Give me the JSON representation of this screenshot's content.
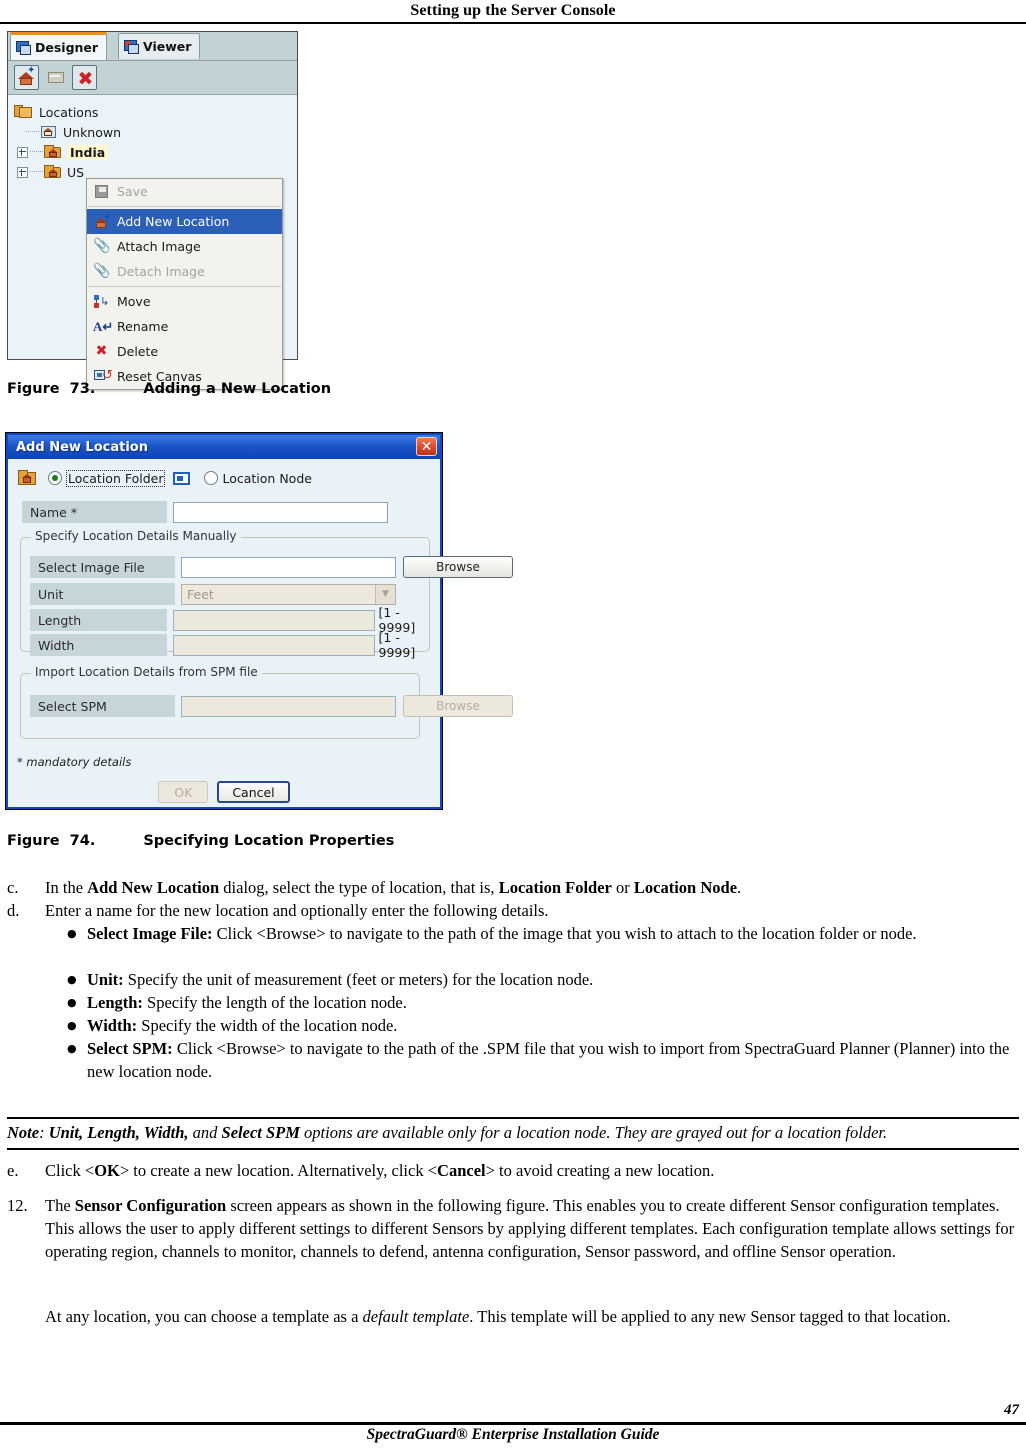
{
  "header": {
    "running_head": "Setting up the Server Console"
  },
  "figure73": {
    "caption_label": "Figure  73.",
    "caption_text": "Adding a New Location",
    "tabs": [
      {
        "label": "Designer",
        "icon": "designer-screen-icon",
        "active": true
      },
      {
        "label": "Viewer",
        "icon": "viewer-screen-icon",
        "active": false
      }
    ],
    "toolbar": [
      {
        "name": "add-location-button",
        "icon": "house-star-icon",
        "enabled": true
      },
      {
        "name": "folder-button",
        "icon": "folder-icon",
        "enabled": false
      },
      {
        "name": "delete-button",
        "icon": "red-x-icon",
        "enabled": true
      }
    ],
    "tree": {
      "root": "Locations",
      "items": [
        {
          "label": "Unknown",
          "icon": "location-node-icon",
          "expandable": false,
          "selected": false
        },
        {
          "label": "India",
          "icon": "location-folder-icon",
          "expandable": true,
          "selected": true
        },
        {
          "label": "US",
          "icon": "location-folder-icon",
          "expandable": true,
          "selected": false
        }
      ]
    },
    "context_menu": [
      {
        "label": "Save",
        "icon": "save-disk-icon",
        "enabled": false,
        "highlighted": false
      },
      {
        "label": "Add New Location",
        "icon": "add-location-icon",
        "enabled": true,
        "highlighted": true
      },
      {
        "label": "Attach Image",
        "icon": "paperclip-icon",
        "enabled": true,
        "highlighted": false
      },
      {
        "label": "Detach Image",
        "icon": "paperclip-cut-icon",
        "enabled": false,
        "highlighted": false
      },
      {
        "label": "Move",
        "icon": "move-icon",
        "enabled": true,
        "highlighted": false
      },
      {
        "label": "Rename",
        "icon": "rename-icon",
        "enabled": true,
        "highlighted": false
      },
      {
        "label": "Delete",
        "icon": "delete-x-icon",
        "enabled": true,
        "highlighted": false
      },
      {
        "label": "Reset Canvas",
        "icon": "reset-canvas-icon",
        "enabled": true,
        "highlighted": false
      }
    ]
  },
  "figure74": {
    "caption_label": "Figure  74.",
    "caption_text": "Specifying Location Properties",
    "dialog": {
      "title": "Add New Location",
      "close_label": "✕",
      "type_selector": {
        "folder_label": "Location Folder",
        "folder_selected": true,
        "node_label": "Location Node",
        "node_selected": false
      },
      "name_field": {
        "label": "Name *",
        "value": "",
        "placeholder": ""
      },
      "group_manual": {
        "title": "Specify Location Details Manually",
        "rows": [
          {
            "label": "Select Image File",
            "value": "",
            "button": "Browse",
            "button_enabled": true,
            "disabled": false,
            "hint": ""
          },
          {
            "label": "Unit",
            "value": "Feet",
            "control": "dropdown",
            "disabled": true,
            "hint": ""
          },
          {
            "label": "Length",
            "value": "",
            "disabled": true,
            "hint": "[1 - 9999]"
          },
          {
            "label": "Width",
            "value": "",
            "disabled": true,
            "hint": "[1 - 9999]"
          }
        ]
      },
      "group_spm": {
        "title": "Import Location Details from SPM file",
        "rows": [
          {
            "label": "Select SPM",
            "value": "",
            "button": "Browse",
            "button_enabled": false,
            "disabled": true,
            "hint": ""
          }
        ]
      },
      "mandatory_note": "* mandatory details",
      "buttons": [
        {
          "label": "OK",
          "enabled": false
        },
        {
          "label": "Cancel",
          "enabled": true
        }
      ]
    }
  },
  "body": {
    "step_c": {
      "marker": "c.",
      "parts": [
        {
          "t": "In the ",
          "s": "n"
        },
        {
          "t": "Add New Location",
          "s": "b"
        },
        {
          "t": " dialog, select the type of location, that is, ",
          "s": "n"
        },
        {
          "t": "Location Folder",
          "s": "b"
        },
        {
          "t": " or ",
          "s": "n"
        },
        {
          "t": "Location Node",
          "s": "b"
        },
        {
          "t": ".",
          "s": "n"
        }
      ]
    },
    "step_d": {
      "marker": "d.",
      "text": "Enter a name for the new location and optionally enter the following details."
    },
    "bullets": [
      {
        "term": "Select Image File:",
        "text": " Click <Browse> to navigate to the path of the image that you wish to attach to the location folder or node."
      },
      {
        "term": "Unit:",
        "text": " Specify the unit of measurement (feet or meters) for the location node."
      },
      {
        "term": "Length:",
        "text": " Specify the length of the location node."
      },
      {
        "term": "Width:",
        "text": " Specify the width of the location node."
      },
      {
        "term": "Select SPM:",
        "text": " Click <Browse> to navigate to the path of the .SPM file that you wish to import from SpectraGuard Planner (Planner) into the new location node."
      }
    ],
    "note": {
      "lead": "Note",
      "colon": ": ",
      "terms": "Unit, Length, Width,",
      "mid": " and ",
      "terms2": "Select SPM",
      "rest": " options are available only for a location node. They are grayed out for a location folder."
    },
    "step_e": {
      "marker": "e.",
      "pre": "Click <",
      "ok": "OK",
      "mid": "> to create a new location. Alternatively, click <",
      "cancel": "Cancel",
      "post": "> to avoid creating a new location."
    },
    "step_12": {
      "marker": "12.",
      "pre": "The ",
      "bold": "Sensor Configuration",
      "post": " screen appears as shown in the following figure. This enables you to create different Sensor configuration templates. This allows the user to apply different settings to different Sensors by applying different templates. Each configuration template allows settings for operating region, channels to monitor, channels to defend, antenna configuration, Sensor password, and offline Sensor operation."
    },
    "paragraph_default": {
      "pre": "At any location, you can choose a template as a ",
      "italic": "default template",
      "post": ". This template will be applied to any new Sensor tagged to that location."
    }
  },
  "footer": {
    "page_number": "47",
    "guide_title": "SpectraGuard® Enterprise Installation Guide"
  }
}
